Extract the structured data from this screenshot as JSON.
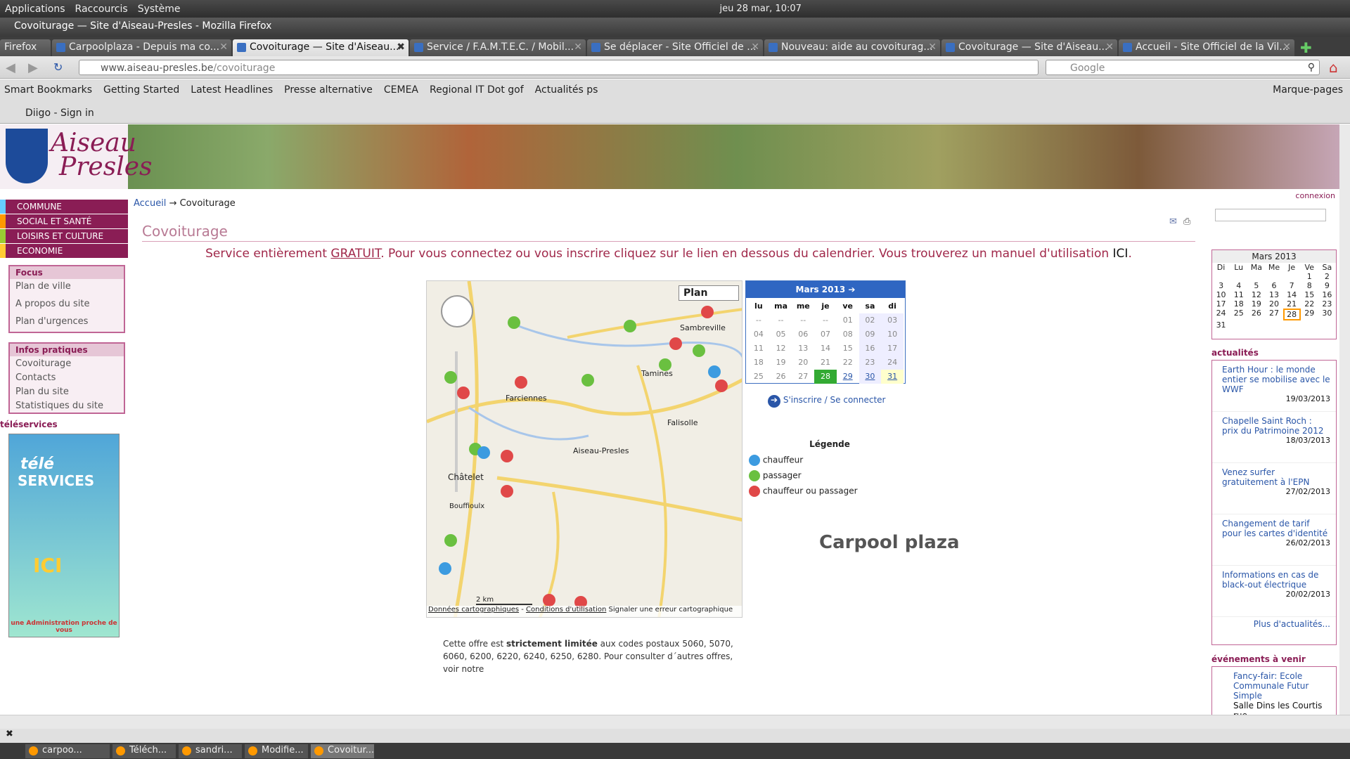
{
  "topbar": {
    "menus": [
      "Applications",
      "Raccourcis",
      "Système"
    ],
    "clock": "jeu 28 mar, 10:07"
  },
  "window": {
    "title": "Covoiturage — Site d'Aiseau-Presles - Mozilla Firefox"
  },
  "tabs": {
    "firefox_label": "Firefox",
    "items": [
      {
        "label": "Carpoolplaza - Depuis ma co..."
      },
      {
        "label": "Covoiturage — Site d'Aiseau..."
      },
      {
        "label": "Service / F.A.M.T.E.C. / Mobil..."
      },
      {
        "label": "Se déplacer - Site Officiel de ..."
      },
      {
        "label": "Nouveau: aide au covoiturag..."
      },
      {
        "label": "Covoiturage — Site d'Aiseau..."
      },
      {
        "label": "Accueil - Site Officiel de la Vil..."
      }
    ]
  },
  "nav": {
    "url_host": "www.aiseau-presles.be",
    "url_path": "/covoiturage",
    "search_placeholder": "Google"
  },
  "bookmarks": {
    "items": [
      "Smart Bookmarks",
      "Getting Started",
      "Latest Headlines",
      "Presse alternative",
      "CEMEA",
      "Regional IT Dot gof",
      "Actualités ps"
    ],
    "right": "Marque-pages",
    "row2": "Diigo - Sign in"
  },
  "site": {
    "brand_line1": "Aiseau",
    "brand_line2": "Presles",
    "connexion": "connexion",
    "menu": [
      "COMMUNE",
      "SOCIAL ET SANTÉ",
      "LOISIRS ET CULTURE",
      "ECONOMIE"
    ],
    "focus": {
      "title": "Focus",
      "items": [
        "Plan de ville",
        "A propos du site",
        "Plan d'urgences"
      ]
    },
    "infos": {
      "title": "Infos pratiques",
      "items": [
        "Covoiturage",
        "Contacts",
        "Plan du site",
        "Statistiques du site"
      ]
    },
    "teleservices": "téléservices",
    "tele_img": {
      "line1": "télé",
      "line2": "SERVICES",
      "ici": "ICI",
      "footer": "une Administration proche de vous"
    }
  },
  "breadcrumb": {
    "home": "Accueil",
    "arrow": "→",
    "current": "Covoiturage"
  },
  "main": {
    "title": "Covoiturage",
    "intro_pre": "Service entièrement ",
    "intro_link": "GRATUIT",
    "intro_post": ". Pour vous connectez ou vous inscrire cliquez sur le lien en dessous du calendrier. Vous trouverez un manuel d'utilisation ",
    "intro_ici": "ICI",
    "intro_end": ".",
    "map": {
      "mode": "Plan",
      "places": [
        "Sambreville",
        "Farciennes",
        "Tamines",
        "Aiseau-Presles",
        "Falisolle",
        "Châtelet",
        "Bouffioulx",
        "Farciennes"
      ],
      "scale": "2 km",
      "footer": [
        "Données cartographiques",
        "Conditions d'utilisation",
        "Signaler une erreur cartographique"
      ]
    },
    "calendar": {
      "title": "Mars 2013",
      "days": [
        "lu",
        "ma",
        "me",
        "je",
        "ve",
        "sa",
        "di"
      ],
      "cells": [
        "--",
        "--",
        "--",
        "--",
        "01",
        "02",
        "03",
        "04",
        "05",
        "06",
        "07",
        "08",
        "09",
        "10",
        "11",
        "12",
        "13",
        "14",
        "15",
        "16",
        "17",
        "18",
        "19",
        "20",
        "21",
        "22",
        "23",
        "24",
        "25",
        "26",
        "27",
        "28",
        "29",
        "30",
        "31"
      ]
    },
    "signin": "S'inscrire / Se connecter",
    "legend": {
      "title": "Légende",
      "items": [
        {
          "label": "chauffeur",
          "color": "#3c9be0"
        },
        {
          "label": "passager",
          "color": "#6ac040"
        },
        {
          "label": "chauffeur ou passager",
          "color": "#e04848"
        }
      ]
    },
    "carpool_logo": "Carpool plaza",
    "note_pre": "Cette offre est ",
    "note_bold": "strictement limitée",
    "note_post": " aux codes postaux 5060, 5070, 6060, 6200, 6220, 6240, 6250, 6280. Pour consulter d´autres offres, voir notre"
  },
  "right": {
    "minical": {
      "title": "Mars 2013",
      "days": [
        "Di",
        "Lu",
        "Ma",
        "Me",
        "Je",
        "Ve",
        "Sa"
      ],
      "cells": [
        "",
        "",
        "",
        "",
        "",
        "1",
        "2",
        "3",
        "4",
        "5",
        "6",
        "7",
        "8",
        "9",
        "10",
        "11",
        "12",
        "13",
        "14",
        "15",
        "16",
        "17",
        "18",
        "19",
        "20",
        "21",
        "22",
        "23",
        "24",
        "25",
        "26",
        "27",
        "28",
        "29",
        "30",
        "31"
      ]
    },
    "actualites": "actualités",
    "news": [
      {
        "title": "Earth Hour : le monde entier se mobilise avec le WWF",
        "date": "19/03/2013"
      },
      {
        "title": "Chapelle Saint Roch : prix du Patrimoine 2012",
        "date": "18/03/2013"
      },
      {
        "title": "Venez surfer gratuitement à l'EPN",
        "date": "27/02/2013"
      },
      {
        "title": "Changement de tarif pour les cartes d'identité",
        "date": "26/02/2013"
      },
      {
        "title": "Informations en cas de black-out électrique",
        "date": "20/02/2013"
      }
    ],
    "more": "Plus d'actualités...",
    "events_title": "événements à venir",
    "event": {
      "title": "Fancy-fair: Ecole Communale Futur Simple",
      "place": "Salle Dins les Courtis rue"
    }
  },
  "taskbar": {
    "items": [
      "carpoo...",
      "Téléch...",
      "sandri...",
      "Modifie...",
      "Covoitur..."
    ]
  }
}
